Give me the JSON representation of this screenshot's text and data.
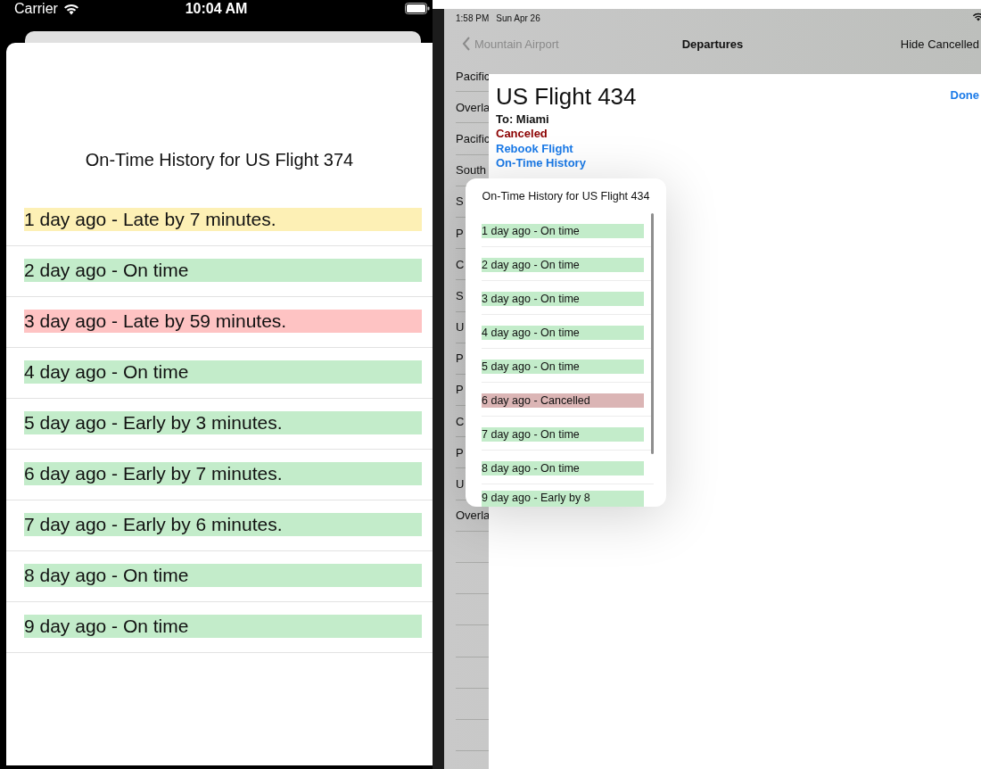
{
  "phone": {
    "status_bar": {
      "carrier": "Carrier",
      "time": "10:04 AM"
    },
    "sheet": {
      "title": "On-Time History for US Flight 374",
      "entries": [
        {
          "text": "1 day ago - Late by 7 minutes.",
          "color": "#fdf0b5"
        },
        {
          "text": "2 day ago - On time",
          "color": "#c3ecca"
        },
        {
          "text": "3 day ago - Late by 59 minutes.",
          "color": "#fec3c3"
        },
        {
          "text": "4 day ago - On time",
          "color": "#c3ecca"
        },
        {
          "text": "5 day ago - Early by 3 minutes.",
          "color": "#c3ecca"
        },
        {
          "text": "6 day ago - Early by 7 minutes.",
          "color": "#c3ecca"
        },
        {
          "text": "7 day ago - Early by 6 minutes.",
          "color": "#c3ecca"
        },
        {
          "text": "8 day ago - On time",
          "color": "#c3ecca"
        },
        {
          "text": "9 day ago - On time",
          "color": "#c3ecca"
        }
      ]
    }
  },
  "tablet": {
    "status_bar": {
      "time": "1:58 PM",
      "date": "Sun Apr 26"
    },
    "nav_bar": {
      "back": "Mountain Airport",
      "title": "Departures",
      "action": "Hide Cancelled"
    },
    "list": {
      "rows": [
        {
          "label": "Pacific"
        },
        {
          "label": "Overla"
        },
        {
          "label": "Pacific"
        },
        {
          "label": "South"
        },
        {
          "label": "S"
        },
        {
          "label": "P"
        },
        {
          "label": "C"
        },
        {
          "label": "S"
        },
        {
          "label": "U"
        },
        {
          "label": "P"
        },
        {
          "label": "P"
        },
        {
          "label": "C"
        },
        {
          "label": "P"
        },
        {
          "label": "U"
        },
        {
          "label": "Overla"
        }
      ]
    },
    "detail": {
      "title": "US Flight 434",
      "destination": "To: Miami",
      "status": "Canceled",
      "actions": [
        "Rebook Flight",
        "On-Time History"
      ],
      "done": "Done"
    },
    "popover": {
      "title": "On-Time History for US Flight 434",
      "entries": [
        {
          "text": "1 day ago - On time",
          "color": "#c3ecca"
        },
        {
          "text": "2 day ago - On time",
          "color": "#c3ecca"
        },
        {
          "text": "3 day ago - On time",
          "color": "#c3ecca"
        },
        {
          "text": "4 day ago - On time",
          "color": "#c3ecca"
        },
        {
          "text": "5 day ago - On time",
          "color": "#c3ecca"
        },
        {
          "text": "6 day ago - Cancelled",
          "color": "#dbb5b5"
        },
        {
          "text": "7 day ago - On time",
          "color": "#c3ecca"
        },
        {
          "text": "8 day ago - On time",
          "color": "#c3ecca"
        },
        {
          "text": "9 day ago - Early by 8",
          "color": "#c3ecca"
        }
      ]
    }
  }
}
